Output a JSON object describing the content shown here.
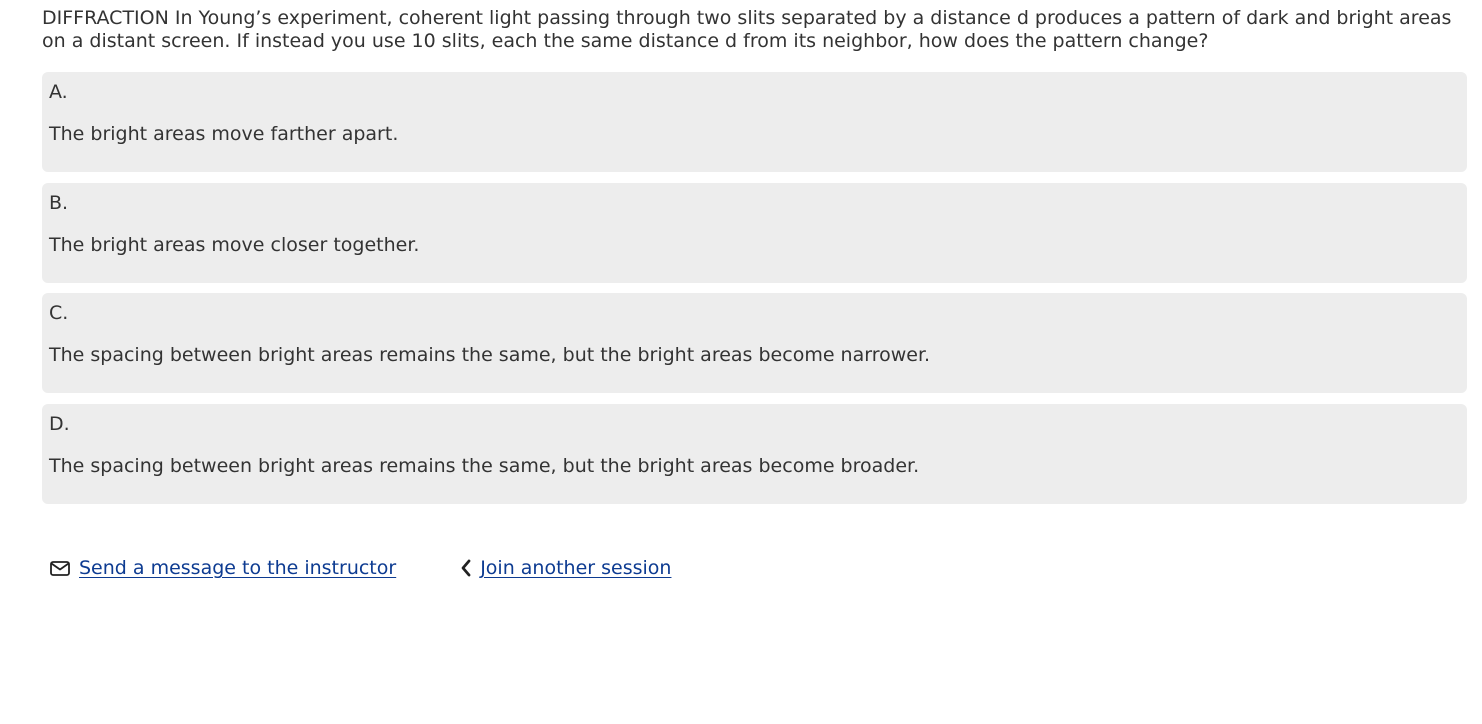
{
  "question": {
    "text": "DIFFRACTION In Young’s experiment, coherent light passing through two slits separated by a distance d produces a pattern of dark and bright areas on a distant screen. If instead you use 10 slits, each the same distance d from its neighbor, how does the pattern change?"
  },
  "choices": [
    {
      "letter": "A.",
      "text": "The bright areas move farther apart."
    },
    {
      "letter": "B.",
      "text": "The bright areas move closer together."
    },
    {
      "letter": "C.",
      "text": "The spacing between bright areas remains the same, but the bright areas become narrower."
    },
    {
      "letter": "D.",
      "text": "The spacing between bright areas remains the same, but the bright areas become broader."
    }
  ],
  "footer": {
    "message_link": "Send a message to the instructor",
    "message_icon": "envelope-icon",
    "join_link": "Join another session",
    "join_icon": "chevron-left-icon"
  },
  "colors": {
    "choice_background": "#ededed",
    "link": "#0d3b91",
    "text": "#333333"
  }
}
